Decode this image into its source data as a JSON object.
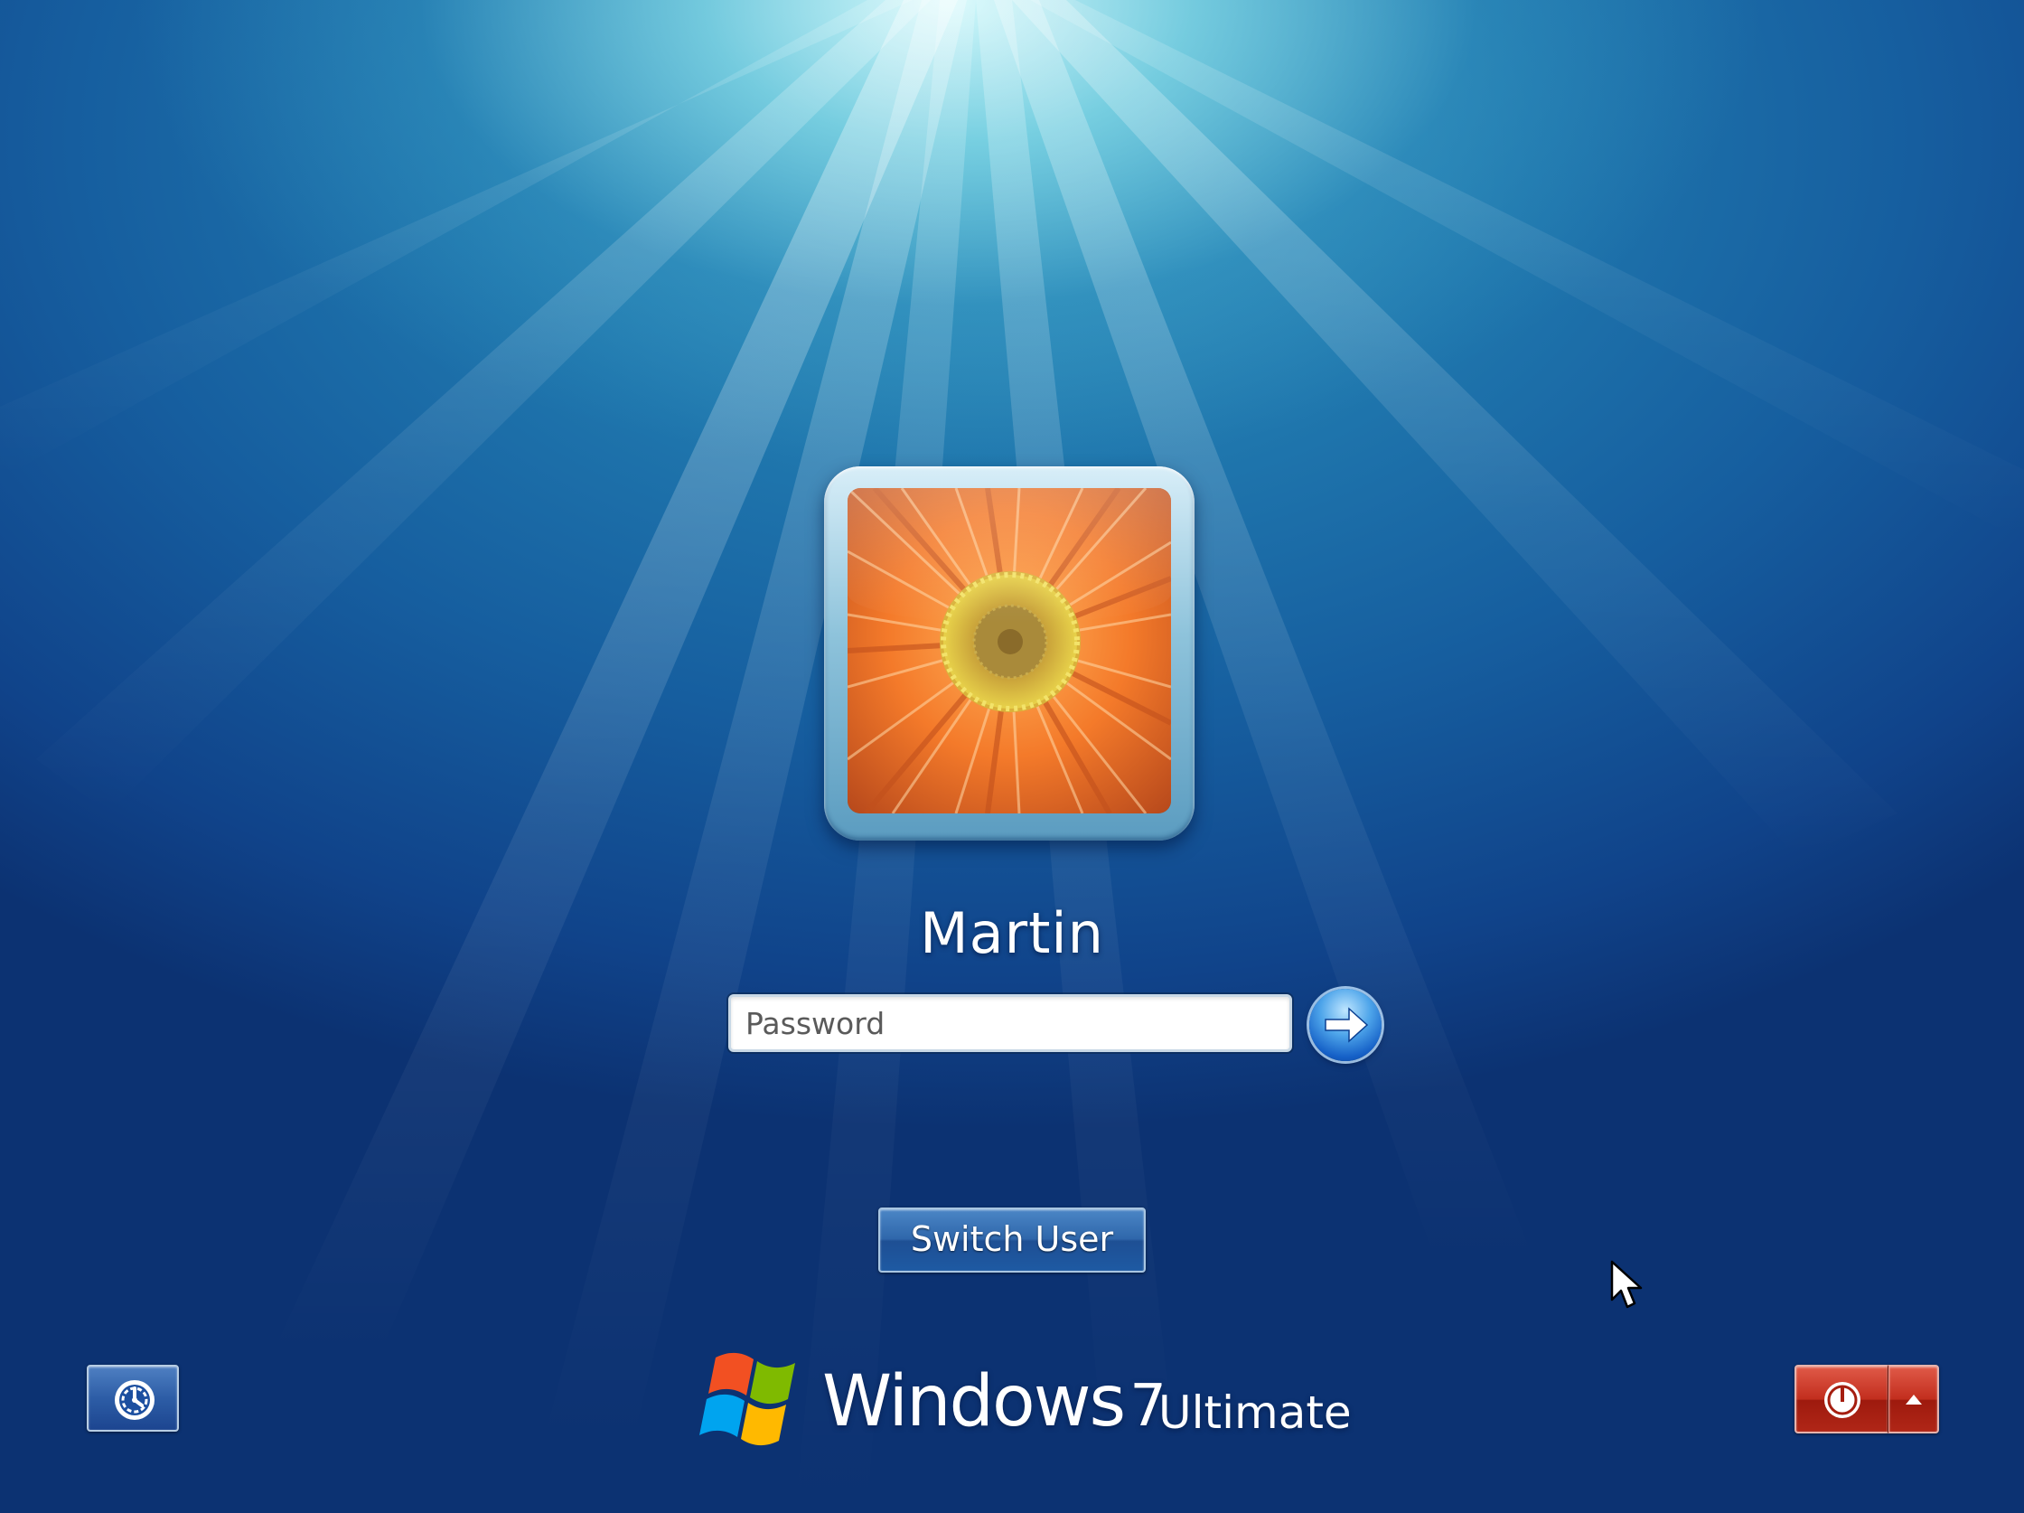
{
  "user": {
    "name": "Martin",
    "avatar": "orange-gerbera-flower"
  },
  "login": {
    "password_placeholder": "Password",
    "password_value": "",
    "submit_icon": "arrow-right-icon"
  },
  "actions": {
    "switch_user_label": "Switch User",
    "ease_of_access_icon": "ease-of-access-icon",
    "shutdown_icon": "power-icon",
    "shutdown_options_icon": "triangle-up-icon"
  },
  "branding": {
    "product": "Windows",
    "version": "7",
    "edition": "Ultimate",
    "logo": "windows-flag-logo"
  },
  "colors": {
    "background_light": "#c8f5f8",
    "background_dark": "#0c3272",
    "shutdown_red": "#c22e1e",
    "button_blue": "#2f67ab"
  }
}
